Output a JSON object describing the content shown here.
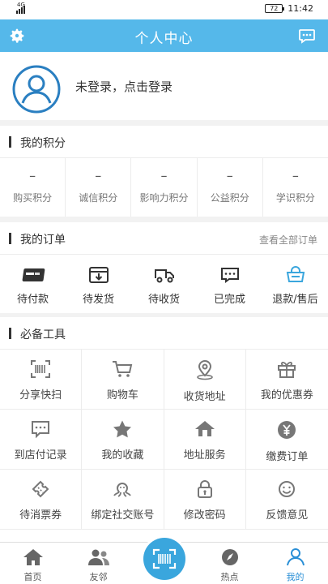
{
  "status_bar": {
    "network": "4G",
    "battery": "72",
    "time": "11:42"
  },
  "header": {
    "title": "个人中心",
    "settings_icon": "gear-icon",
    "message_icon": "chat-bubble-icon"
  },
  "profile": {
    "login_prompt": "未登录，点击登录"
  },
  "points": {
    "title": "我的积分",
    "items": [
      {
        "value": "–",
        "label": "购买积分"
      },
      {
        "value": "–",
        "label": "诚信积分"
      },
      {
        "value": "–",
        "label": "影响力积分"
      },
      {
        "value": "–",
        "label": "公益积分"
      },
      {
        "value": "–",
        "label": "学识积分"
      }
    ]
  },
  "orders": {
    "title": "我的订单",
    "view_all": "查看全部订单",
    "items": [
      {
        "label": "待付款",
        "icon": "unionpay-card-icon"
      },
      {
        "label": "待发货",
        "icon": "box-download-icon"
      },
      {
        "label": "待收货",
        "icon": "truck-icon"
      },
      {
        "label": "已完成",
        "icon": "chat-dots-icon"
      },
      {
        "label": "退款/售后",
        "icon": "shopping-basket-icon"
      }
    ]
  },
  "tools": {
    "title": "必备工具",
    "items": [
      {
        "label": "分享快扫",
        "icon": "barcode-scan-icon"
      },
      {
        "label": "购物车",
        "icon": "cart-icon"
      },
      {
        "label": "收货地址",
        "icon": "location-pin-icon"
      },
      {
        "label": "我的优惠券",
        "icon": "gift-icon"
      },
      {
        "label": "到店付记录",
        "icon": "message-dots-icon"
      },
      {
        "label": "我的收藏",
        "icon": "star-icon"
      },
      {
        "label": "地址服务",
        "icon": "house-icon"
      },
      {
        "label": "缴费订单",
        "icon": "yen-coin-icon"
      },
      {
        "label": "待消票券",
        "icon": "ticket-icon"
      },
      {
        "label": "绑定社交账号",
        "icon": "octopus-icon"
      },
      {
        "label": "修改密码",
        "icon": "lock-icon"
      },
      {
        "label": "反馈意见",
        "icon": "smile-icon"
      }
    ]
  },
  "tabbar": {
    "items": [
      {
        "label": "首页",
        "icon": "home-icon"
      },
      {
        "label": "友邻",
        "icon": "people-icon"
      },
      {
        "label": "",
        "icon": "scan-icon"
      },
      {
        "label": "热点",
        "icon": "compass-icon"
      },
      {
        "label": "我的",
        "icon": "person-icon"
      }
    ],
    "active": "我的"
  },
  "colors": {
    "accent": "#55b8ea",
    "active_tab": "#2a8fd6",
    "scan_button": "#3aa6dd"
  }
}
